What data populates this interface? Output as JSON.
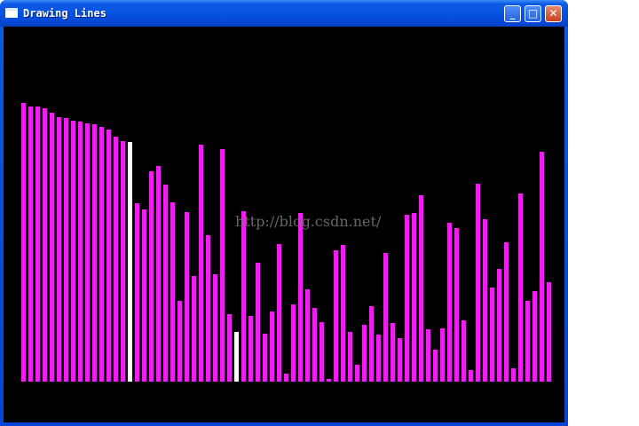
{
  "window": {
    "title": "Drawing Lines",
    "minimize_label": "_",
    "maximize_label": "□",
    "close_label": "✕"
  },
  "watermark": "http://blog.csdn.net/",
  "colors": {
    "bar": "#f01ef0",
    "highlight": "#ffffff",
    "background": "#000000",
    "titlebar": "#0553e1"
  },
  "chart_data": {
    "type": "bar",
    "values": [
      314,
      310,
      310,
      308,
      303,
      298,
      297,
      294,
      293,
      291,
      290,
      287,
      284,
      276,
      271,
      270,
      201,
      194,
      237,
      243,
      222,
      202,
      91,
      191,
      119,
      267,
      165,
      121,
      262,
      76,
      56,
      192,
      74,
      134,
      54,
      79,
      155,
      9,
      87,
      190,
      104,
      83,
      67,
      3,
      148,
      154,
      56,
      19,
      64,
      85,
      53,
      145,
      66,
      49,
      188,
      190,
      210,
      59,
      36,
      60,
      179,
      173,
      69,
      13,
      223,
      183,
      106,
      127,
      157,
      15,
      212,
      91,
      102,
      259,
      112
    ],
    "highlighted_indices": [
      15,
      30
    ]
  }
}
